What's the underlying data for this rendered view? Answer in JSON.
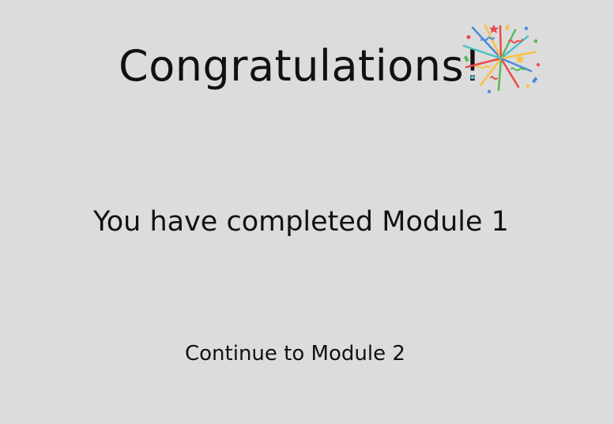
{
  "page": {
    "title": "Congratulations!",
    "message": "You have completed Module 1",
    "continue_label": "Continue to Module 2"
  },
  "icons": {
    "celebration": "confetti-popper-icon"
  },
  "colors": {
    "background": "#dcdcdc",
    "text": "#111111",
    "confetti_red": "#e94b4b",
    "confetti_blue": "#4a89dc",
    "confetti_yellow": "#f6c343",
    "confetti_green": "#57b85b",
    "confetti_teal": "#4ac2c7"
  }
}
